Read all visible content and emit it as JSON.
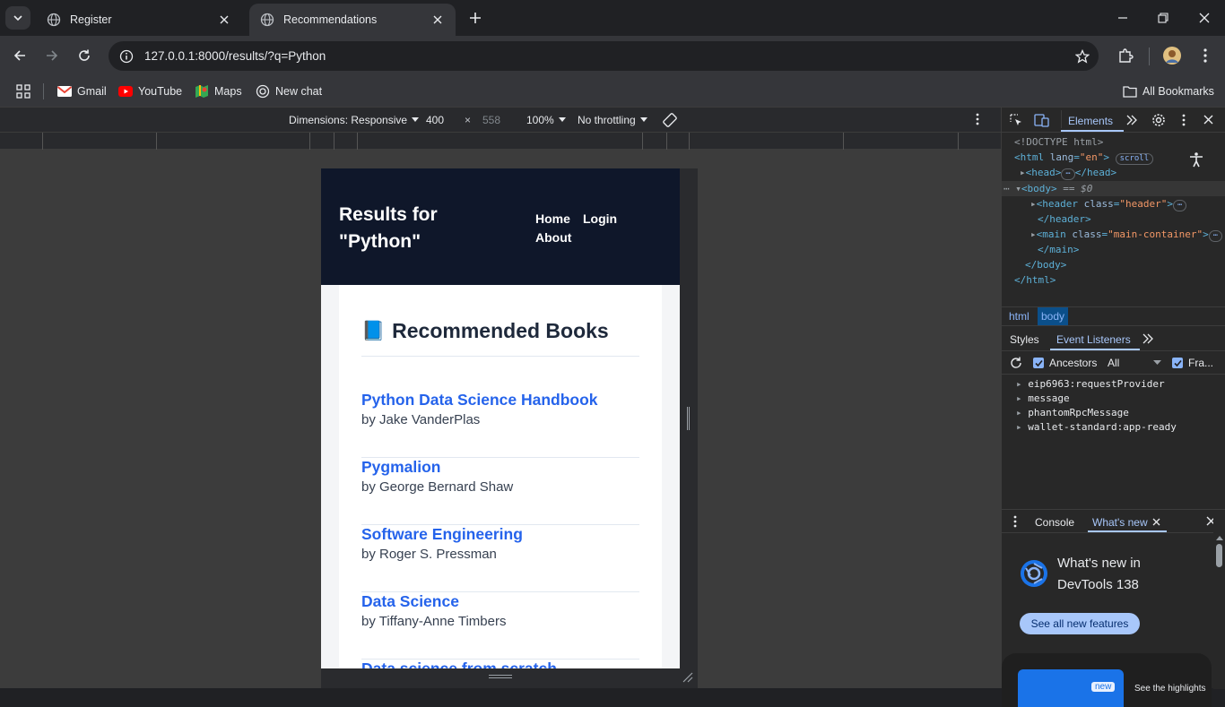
{
  "browser": {
    "tabs": [
      {
        "title": "Register"
      },
      {
        "title": "Recommendations"
      }
    ],
    "url": "127.0.0.1:8000/results/?q=Python",
    "bookmarks": [
      {
        "label": "Gmail"
      },
      {
        "label": "YouTube"
      },
      {
        "label": "Maps"
      },
      {
        "label": "New chat"
      }
    ],
    "all_bookmarks": "All Bookmarks"
  },
  "device_toolbar": {
    "dimensions": "Dimensions: Responsive",
    "width": "400",
    "times": "×",
    "height": "558",
    "zoom": "100%",
    "throttling": "No throttling"
  },
  "site": {
    "title": "Results for \"Python\"",
    "nav": {
      "home": "Home",
      "login": "Login",
      "about": "About"
    },
    "heading_icon": "📘",
    "heading": "Recommended Books",
    "books": [
      {
        "title": "Python Data Science Handbook",
        "author": "by Jake VanderPlas"
      },
      {
        "title": "Pygmalion",
        "author": "by George Bernard Shaw"
      },
      {
        "title": "Software Engineering",
        "author": "by Roger S. Pressman"
      },
      {
        "title": "Data Science",
        "author": "by Tiffany-Anne Timbers"
      },
      {
        "title": "Data science from scratch",
        "author": ""
      }
    ]
  },
  "devtools": {
    "main_tab": "Elements",
    "dom": {
      "doctype": "<!DOCTYPE html>",
      "html_open": "<html",
      "lang_attr": "lang",
      "lang_val": "\"en\"",
      "scroll_pill": "scroll",
      "head": "<head>",
      "head_close": "</head>",
      "body": "<body>",
      "body_marker": "== $0",
      "header_open": "<header",
      "class_attr": "class",
      "header_val": "\"header\"",
      "header_close": "</header>",
      "main_open": "<main",
      "main_val": "\"main-container\"",
      "main_close": "</main>",
      "body_close": "</body>",
      "html_close": "</html>"
    },
    "crumbs": [
      "html",
      "body"
    ],
    "subtabs": {
      "styles": "Styles",
      "event_listeners": "Event Listeners"
    },
    "filter": {
      "ancestors": "Ancestors",
      "all": "All",
      "framework": "Fra..."
    },
    "listeners": [
      "eip6963:requestProvider",
      "message",
      "phantomRpcMessage",
      "wallet-standard:app-ready"
    ],
    "drawer": {
      "console": "Console",
      "whats_new": "What's new",
      "title_line1": "What's new in",
      "title_line2": "DevTools 138",
      "button": "See all new features",
      "new_badge": "new",
      "highlights": "See the highlights"
    }
  }
}
